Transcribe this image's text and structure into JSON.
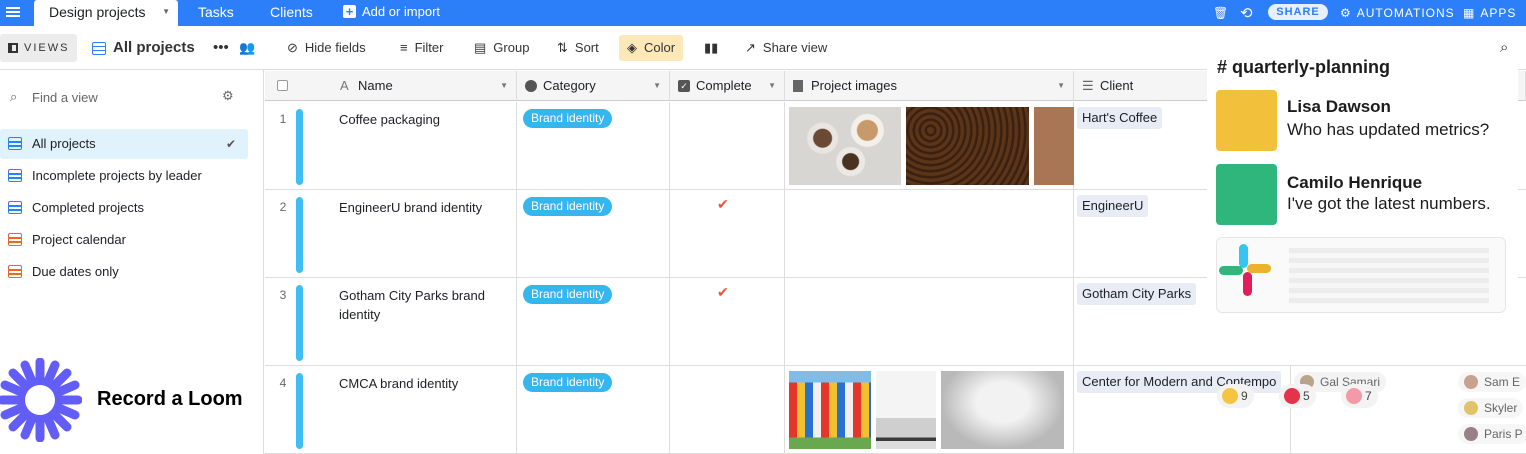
{
  "topbar": {
    "base_tab": "Design projects",
    "tabs": [
      "Tasks",
      "Clients"
    ],
    "add_import": "Add or import",
    "share": "SHARE",
    "automations": "AUTOMATIONS",
    "apps": "APPS"
  },
  "viewbar": {
    "views": "VIEWS",
    "current_view": "All projects",
    "hide_fields": "Hide fields",
    "filter": "Filter",
    "group": "Group",
    "sort": "Sort",
    "color": "Color",
    "share_view": "Share view"
  },
  "sidebar": {
    "find_placeholder": "Find a view",
    "views": [
      {
        "label": "All projects",
        "type": "grid",
        "selected": true
      },
      {
        "label": "Incomplete projects by leader",
        "type": "grid"
      },
      {
        "label": "Completed projects",
        "type": "grid"
      },
      {
        "label": "Project calendar",
        "type": "calendar"
      },
      {
        "label": "Due dates only",
        "type": "calendar"
      }
    ],
    "loom": "Record a Loom"
  },
  "grid": {
    "columns": [
      "Name",
      "Category",
      "Complete",
      "Project images",
      "Client"
    ],
    "rows": [
      {
        "num": "1",
        "name": "Coffee packaging",
        "category": "Brand identity",
        "complete": false,
        "client": "Hart's Coffee"
      },
      {
        "num": "2",
        "name": "EngineerU brand identity",
        "category": "Brand identity",
        "complete": true,
        "client": "EngineerU"
      },
      {
        "num": "3",
        "name": "Gotham City Parks brand identity",
        "category": "Brand identity",
        "complete": true,
        "client": "Gotham City Parks"
      },
      {
        "num": "4",
        "name": "CMCA brand identity",
        "category": "Brand identity",
        "complete": false,
        "client": "Center for Modern and Contempo",
        "leader": "Gal Samari"
      }
    ],
    "extra_people": [
      "Sam E",
      "Skyler",
      "Paris P"
    ]
  },
  "slack": {
    "channel": "# quarterly-planning",
    "messages": [
      {
        "name": "Lisa Dawson",
        "text": "Who has updated metrics?",
        "color": "#f2c03b"
      },
      {
        "name": "Camilo Henrique",
        "text": "I've got the latest numbers.",
        "color": "#2fb67c"
      }
    ],
    "reactions": [
      {
        "icon": "raised-hands",
        "count": "9"
      },
      {
        "icon": "target",
        "count": "5"
      },
      {
        "icon": "brain",
        "count": "7"
      }
    ]
  },
  "colors": {
    "accent": "#2d7ff9",
    "pill": "#36b6f0",
    "check": "#e8553a",
    "loom": "#625df5"
  }
}
